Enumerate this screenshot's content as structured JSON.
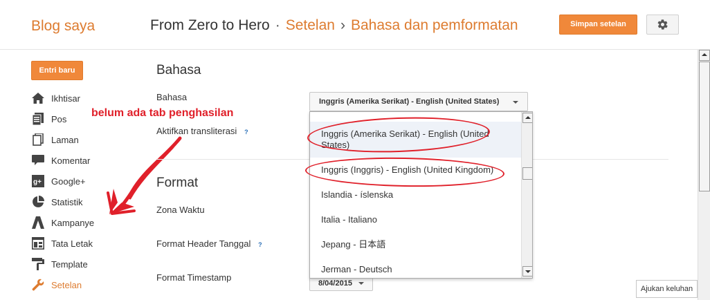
{
  "header": {
    "brand": "Blog saya",
    "blog_name": "From Zero to Hero",
    "dot": "·",
    "crumb_settings": "Setelan",
    "crumb_arrow": "›",
    "crumb_current": "Bahasa dan pemformatan",
    "save_label": "Simpan setelan",
    "settings_icon": "gear-icon"
  },
  "sidebar": {
    "new_post_label": "Entri baru",
    "items": [
      {
        "label": "Ikhtisar",
        "icon": "home-icon"
      },
      {
        "label": "Pos",
        "icon": "posts-icon"
      },
      {
        "label": "Laman",
        "icon": "pages-icon"
      },
      {
        "label": "Komentar",
        "icon": "comment-icon"
      },
      {
        "label": "Google+",
        "icon": "google-plus-icon"
      },
      {
        "label": "Statistik",
        "icon": "stats-pie-icon"
      },
      {
        "label": "Kampanye",
        "icon": "campaign-icon"
      },
      {
        "label": "Tata Letak",
        "icon": "layout-icon"
      },
      {
        "label": "Template",
        "icon": "template-roller-icon"
      },
      {
        "label": "Setelan",
        "icon": "wrench-icon",
        "active": true
      }
    ]
  },
  "annotation": {
    "text": "belum ada tab penghasilan",
    "color": "#e0202a"
  },
  "main": {
    "language_section": {
      "title": "Bahasa",
      "language_label": "Bahasa",
      "transliteration_label": "Aktifkan transliterasi",
      "help": "?",
      "selected_language": "Inggris (Amerika Serikat) - English (United States)"
    },
    "format_section": {
      "title": "Format",
      "timezone_label": "Zona Waktu",
      "date_header_label": "Format Header Tanggal",
      "timestamp_label": "Format Timestamp",
      "help": "?",
      "timestamp_value": "8/04/2015"
    }
  },
  "dropdown": {
    "options": [
      "Inggris (Amerika Serikat) - English (United States)",
      "Inggris (Inggris) - English (United Kingdom)",
      "Islandia - íslenska",
      "Italia - Italiano",
      "Jepang - 日本語",
      "Jerman - Deutsch"
    ]
  },
  "footer": {
    "feedback_label": "Ajukan keluhan"
  },
  "colors": {
    "accent": "#dd7b2f",
    "button": "#f0883a",
    "highlight_circle": "#e0202a"
  }
}
